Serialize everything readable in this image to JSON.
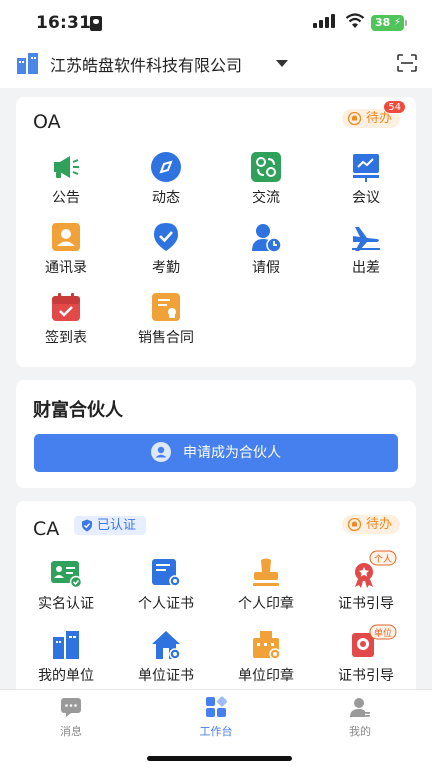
{
  "status": {
    "time": "16:31",
    "battery": "38"
  },
  "header": {
    "company": "江苏皓盘软件科技有限公司"
  },
  "oa": {
    "title": "OA",
    "todo_label": "待办",
    "todo_count": "54",
    "items": [
      {
        "label": "公告",
        "icon": "megaphone-icon"
      },
      {
        "label": "动态",
        "icon": "compass-icon"
      },
      {
        "label": "交流",
        "icon": "exchange-icon"
      },
      {
        "label": "会议",
        "icon": "presentation-icon"
      },
      {
        "label": "通讯录",
        "icon": "contacts-icon"
      },
      {
        "label": "考勤",
        "icon": "checkin-icon"
      },
      {
        "label": "请假",
        "icon": "leave-icon"
      },
      {
        "label": "出差",
        "icon": "airplane-icon"
      },
      {
        "label": "签到表",
        "icon": "calendar-icon"
      },
      {
        "label": "销售合同",
        "icon": "contract-icon"
      }
    ]
  },
  "partner": {
    "title": "财富合伙人",
    "button_label": "申请成为合伙人"
  },
  "ca": {
    "title": "CA",
    "verified_label": "已认证",
    "todo_label": "待办",
    "items": [
      {
        "label": "实名认证",
        "icon": "id-card-icon"
      },
      {
        "label": "个人证书",
        "icon": "certificate-icon"
      },
      {
        "label": "个人印章",
        "icon": "seal-icon"
      },
      {
        "label": "证书引导",
        "icon": "award-icon",
        "tag": "个人"
      },
      {
        "label": "我的单位",
        "icon": "building-icon"
      },
      {
        "label": "单位证书",
        "icon": "house-icon"
      },
      {
        "label": "单位印章",
        "icon": "company-seal-icon"
      },
      {
        "label": "证书引导",
        "icon": "award-icon",
        "tag": "单位"
      }
    ]
  },
  "tabs": [
    {
      "label": "消息",
      "icon": "message-icon",
      "active": false
    },
    {
      "label": "工作台",
      "icon": "workbench-icon",
      "active": true
    },
    {
      "label": "我的",
      "icon": "profile-icon",
      "active": false
    }
  ],
  "colors": {
    "primary": "#4580ee",
    "todo": "#ee8a26",
    "badge": "#ef4b3d"
  }
}
